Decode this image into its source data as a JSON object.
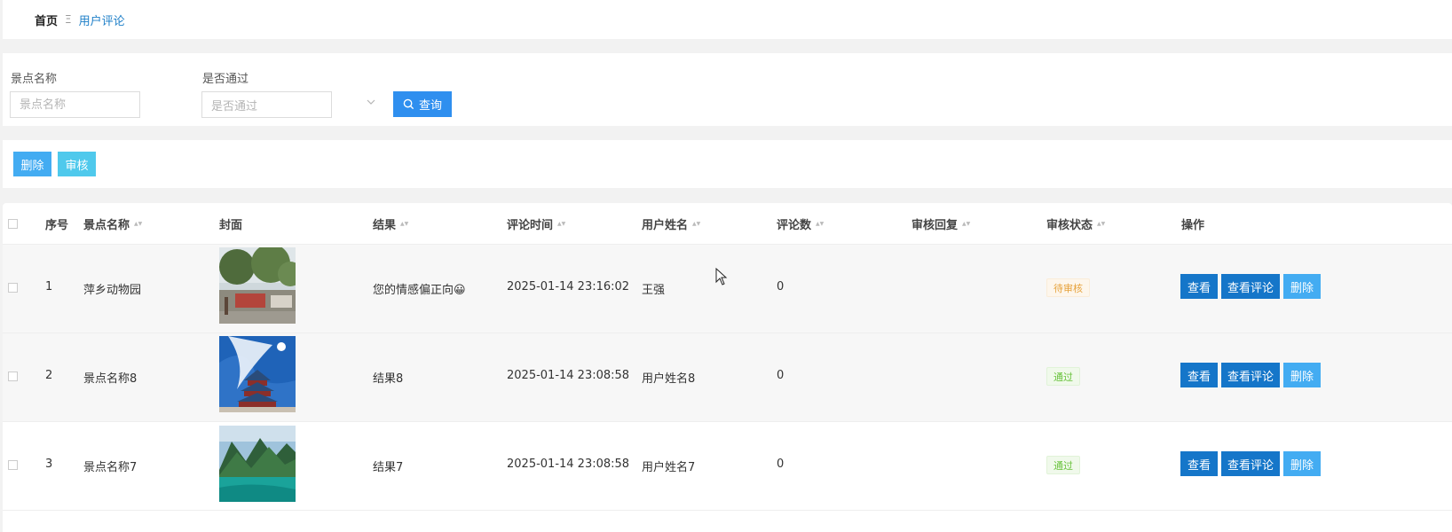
{
  "breadcrumb": {
    "home": "首页",
    "separator": "Ξ",
    "current": "用户评论"
  },
  "search": {
    "scenic_label": "景点名称",
    "scenic_placeholder": "景点名称",
    "approved_label": "是否通过",
    "approved_placeholder": "是否通过",
    "search_button": "查询"
  },
  "actions": {
    "delete": "删除",
    "review": "审核"
  },
  "table": {
    "headers": {
      "index": "序号",
      "scenic": "景点名称",
      "cover": "封面",
      "result": "结果",
      "time": "评论时间",
      "user": "用户姓名",
      "count": "评论数",
      "reply": "审核回复",
      "status": "审核状态",
      "ops": "操作"
    },
    "row_buttons": {
      "view": "查看",
      "view_comments": "查看评论",
      "delete": "删除"
    },
    "rows": [
      {
        "index": "1",
        "scenic": "萍乡动物园",
        "result": "您的情感偏正向😀",
        "time": "2025-01-14 23:16:02",
        "user": "王强",
        "count": "0",
        "reply": "",
        "status": "待审核",
        "cover": "zoo-gate-photo"
      },
      {
        "index": "2",
        "scenic": "景点名称8",
        "result": "结果8",
        "time": "2025-01-14 23:08:58",
        "user": "用户姓名8",
        "count": "0",
        "reply": "",
        "status": "通过",
        "cover": "temple-of-heaven-photo"
      },
      {
        "index": "3",
        "scenic": "景点名称7",
        "result": "结果7",
        "time": "2025-01-14 23:08:58",
        "user": "用户姓名7",
        "count": "0",
        "reply": "",
        "status": "通过",
        "cover": "mountain-lake-photo"
      }
    ]
  },
  "colors": {
    "primary": "#1576c9",
    "search": "#2f8fef",
    "light_blue": "#43acf2",
    "cyan": "#4fc9ec",
    "pending": "#e6a23c",
    "passed": "#67c23a"
  }
}
